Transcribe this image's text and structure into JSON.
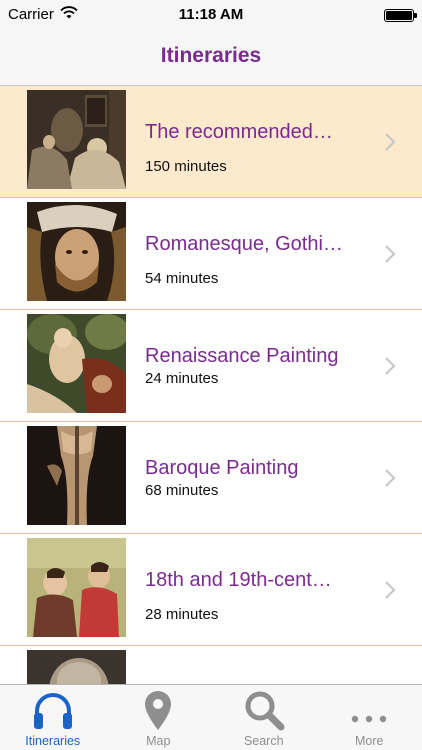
{
  "status_bar": {
    "carrier": "Carrier",
    "time": "11:18 AM"
  },
  "nav": {
    "title": "Itineraries"
  },
  "itineraries": [
    {
      "title": "The recommended…",
      "duration": "150 minutes",
      "selected": true
    },
    {
      "title": "Romanesque, Gothi…",
      "duration": "54 minutes",
      "selected": false
    },
    {
      "title": "Renaissance Painting",
      "duration": "24 minutes",
      "selected": false
    },
    {
      "title": "Baroque Painting",
      "duration": "68 minutes",
      "selected": false
    },
    {
      "title": "18th and 19th-cent…",
      "duration": "28 minutes",
      "selected": false
    },
    {
      "title": "",
      "duration": "",
      "selected": false
    }
  ],
  "tabs": [
    {
      "label": "Itineraries",
      "icon": "headphones-icon",
      "active": true
    },
    {
      "label": "Map",
      "icon": "map-pin-icon",
      "active": false
    },
    {
      "label": "Search",
      "icon": "search-icon",
      "active": false
    },
    {
      "label": "More",
      "icon": "more-icon",
      "active": false
    }
  ],
  "colors": {
    "accent": "#7a2a90",
    "selected_row": "#fde9cc",
    "separator": "#e7c37a",
    "tab_active": "#1a63c9",
    "tab_inactive": "#8e8e8e"
  }
}
